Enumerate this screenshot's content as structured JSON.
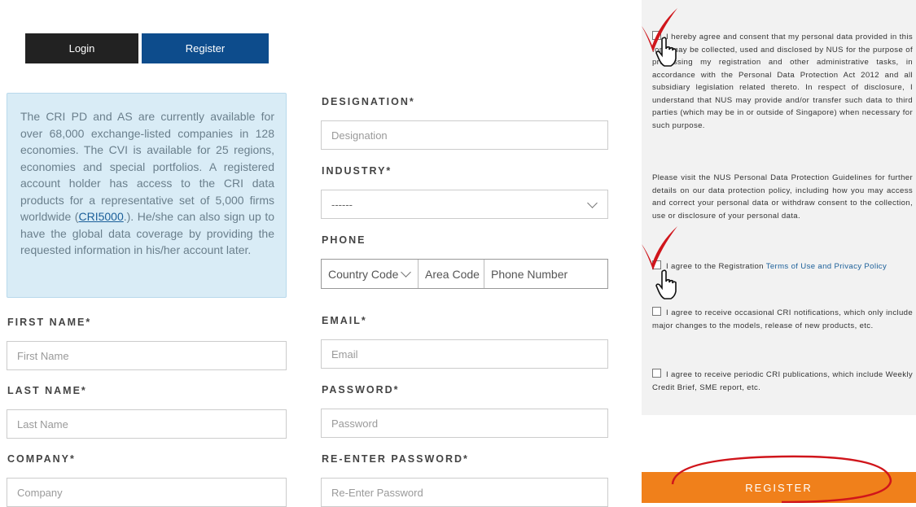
{
  "tabs": {
    "login": "Login",
    "register": "Register"
  },
  "info": {
    "text_before": "The CRI PD and AS are currently available for over 68,000 exchange-listed companies in 128 economies. The CVI is available for 25 regions, economies and special portfolios. A registered account holder has access to the CRI data products for a representative set of 5,000 firms worldwide (",
    "link": "CRI5000",
    "text_after": ".). He/she can also sign up to have the global data coverage by providing the requested information in his/her account later."
  },
  "form": {
    "first_name": {
      "label": "FIRST NAME*",
      "placeholder": "First Name"
    },
    "last_name": {
      "label": "LAST NAME*",
      "placeholder": "Last Name"
    },
    "company": {
      "label": "COMPANY*",
      "placeholder": "Company"
    },
    "designation": {
      "label": "DESIGNATION*",
      "placeholder": "Designation"
    },
    "industry": {
      "label": "INDUSTRY*",
      "value": "------"
    },
    "phone": {
      "label": "PHONE",
      "country_code": "Country Code",
      "area_code": "Area Code",
      "phone_number": "Phone Number"
    },
    "email": {
      "label": "EMAIL*",
      "placeholder": "Email"
    },
    "password": {
      "label": "PASSWORD*",
      "placeholder": "Password"
    },
    "reenter_password": {
      "label": "RE-ENTER PASSWORD*",
      "placeholder": "Re-Enter Password"
    }
  },
  "consent": {
    "p1": "I hereby agree and consent that my personal data provided in this form may be collected, used and disclosed by NUS for the purpose of processing my registration and other administrative tasks, in accordance with the Personal Data Protection Act 2012 and all subsidiary legislation related thereto. In respect of disclosure, I understand that NUS may provide and/or transfer such data to third parties (which may be in or outside of Singapore) when necessary for such purpose.",
    "p2": "Please visit the NUS Personal Data Protection Guidelines for further details on our data protection policy, including how you may access and correct your personal data or withdraw consent to the collection, use or disclosure of your personal data.",
    "terms_text": "I agree to the Registration ",
    "terms_link": "Terms of Use and Privacy Policy",
    "notifications": "I agree to receive occasional CRI notifications, which only include major changes to the models, release of new products, etc.",
    "publications": "I agree to receive periodic CRI publications, which include Weekly Credit Brief, SME report, etc."
  },
  "register_button": "REGISTER",
  "colors": {
    "accent_orange": "#f0801b",
    "tab_blue": "#0d4c8c",
    "tab_dark": "#222222",
    "annotation_red": "#d0151b"
  }
}
